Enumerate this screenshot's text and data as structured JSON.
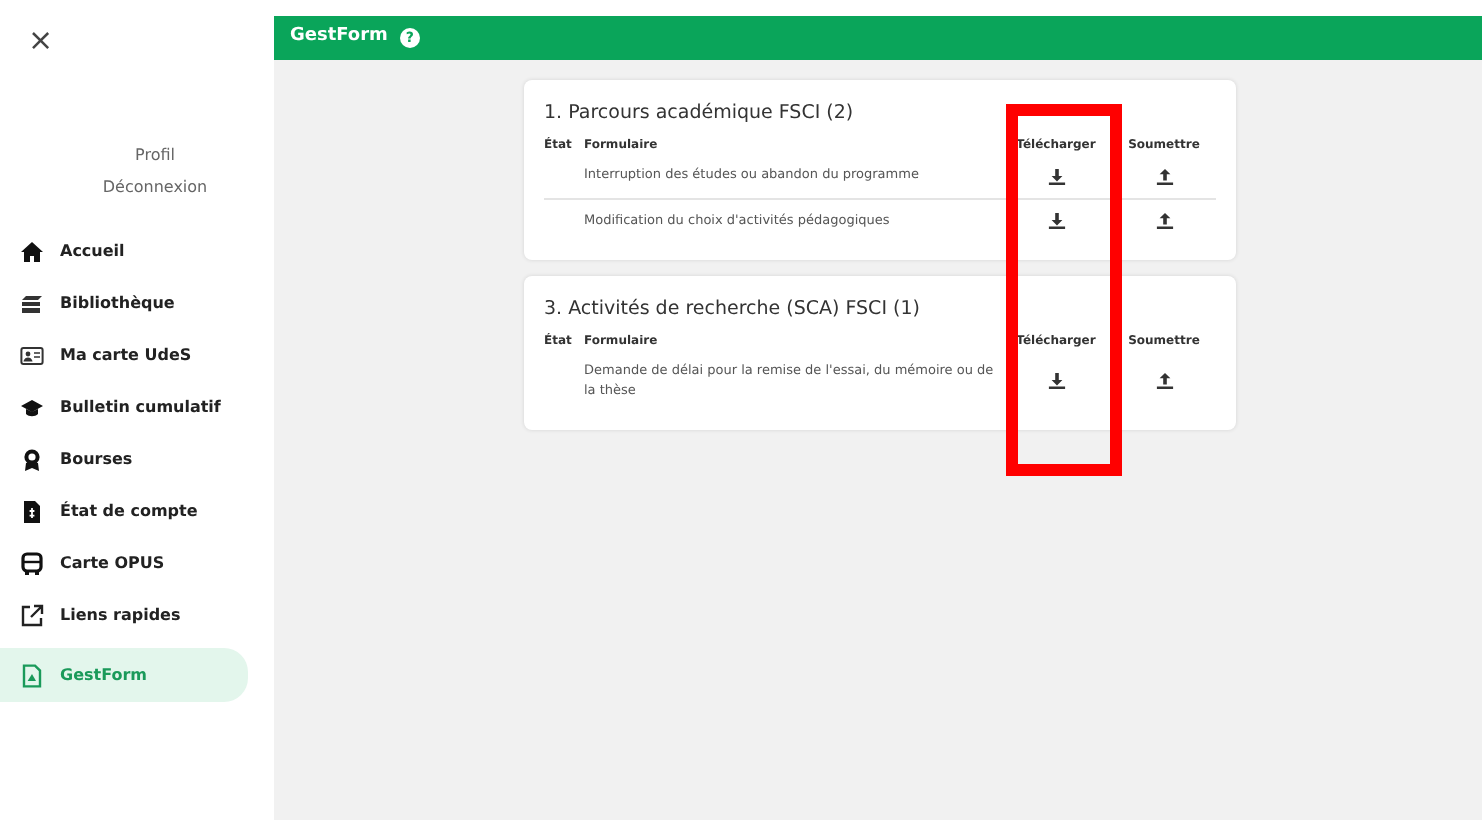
{
  "sidebar": {
    "close": "×",
    "profile_links": [
      "Profil",
      "Déconnexion"
    ],
    "items": [
      {
        "label": "Accueil",
        "selected": false
      },
      {
        "label": "Bibliothèque",
        "selected": false
      },
      {
        "label": "Ma carte UdeS",
        "selected": false
      },
      {
        "label": "Bulletin cumulatif",
        "selected": false
      },
      {
        "label": "Bourses",
        "selected": false
      },
      {
        "label": "État de compte",
        "selected": false
      },
      {
        "label": "Carte OPUS",
        "selected": false
      },
      {
        "label": "Liens rapides",
        "selected": false
      },
      {
        "label": "GestForm",
        "selected": true
      }
    ]
  },
  "header": {
    "title": "GestForm",
    "help": "?"
  },
  "sections": [
    {
      "title": "1. Parcours académique FSCI (2)",
      "columns": [
        "État",
        "Formulaire",
        "Télécharger",
        "Soumettre"
      ],
      "rows": [
        {
          "form": "Interruption des études ou abandon du programme"
        },
        {
          "form": "Modification du choix d'activités pédagogiques"
        }
      ]
    },
    {
      "title": "3. Activités de recherche (SCA) FSCI (1)",
      "columns": [
        "État",
        "Formulaire",
        "Télécharger",
        "Soumettre"
      ],
      "rows": [
        {
          "form": "Demande de délai pour la remise de l'essai, du mémoire ou de la thèse"
        }
      ]
    }
  ],
  "annotations": [
    {
      "kind": "rectangle",
      "color": "#ff0000"
    }
  ]
}
